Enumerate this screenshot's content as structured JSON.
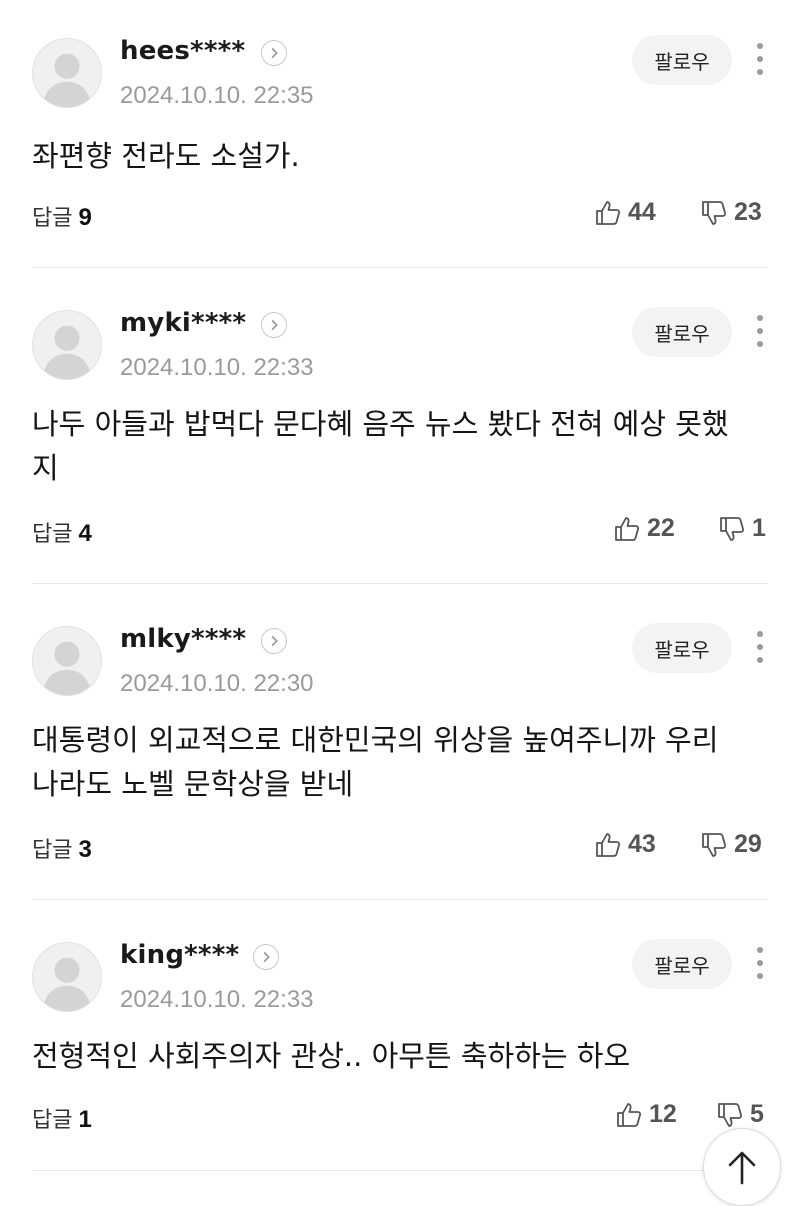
{
  "comments": [
    {
      "username": "hees****",
      "timestamp": "2024.10.10. 22:35",
      "follow_label": "팔로우",
      "text": "좌편향 전라도 소설가.",
      "reply_label": "답글",
      "reply_count": "9",
      "likes": "44",
      "dislikes": "23"
    },
    {
      "username": "myki****",
      "timestamp": "2024.10.10. 22:33",
      "follow_label": "팔로우",
      "text": "나두 아들과 밥먹다 문다혜 음주 뉴스 봤다 전혀 예상 못했지",
      "reply_label": "답글",
      "reply_count": "4",
      "likes": "22",
      "dislikes": "1"
    },
    {
      "username": "mlky****",
      "timestamp": "2024.10.10. 22:30",
      "follow_label": "팔로우",
      "text": "대통령이 외교적으로 대한민국의 위상을 높여주니까 우리나라도 노벨 문학상을 받네",
      "reply_label": "답글",
      "reply_count": "3",
      "likes": "43",
      "dislikes": "29"
    },
    {
      "username": "king****",
      "timestamp": "2024.10.10. 22:33",
      "follow_label": "팔로우",
      "text": "전형적인 사회주의자 관상.. 아무튼 축하하는 하오",
      "reply_label": "답글",
      "reply_count": "1",
      "likes": "12",
      "dislikes": "5"
    }
  ],
  "icons": {
    "avatar": "default-avatar-icon",
    "profile_link": "chevron-right-icon",
    "more": "more-vertical-icon",
    "like": "thumbs-up-icon",
    "dislike": "thumbs-down-icon",
    "scroll_top": "arrow-up-icon"
  },
  "colors": {
    "timestamp": "#9a9a9a",
    "follow_bg": "#f3f3f3",
    "divider": "#e6e6e6"
  }
}
